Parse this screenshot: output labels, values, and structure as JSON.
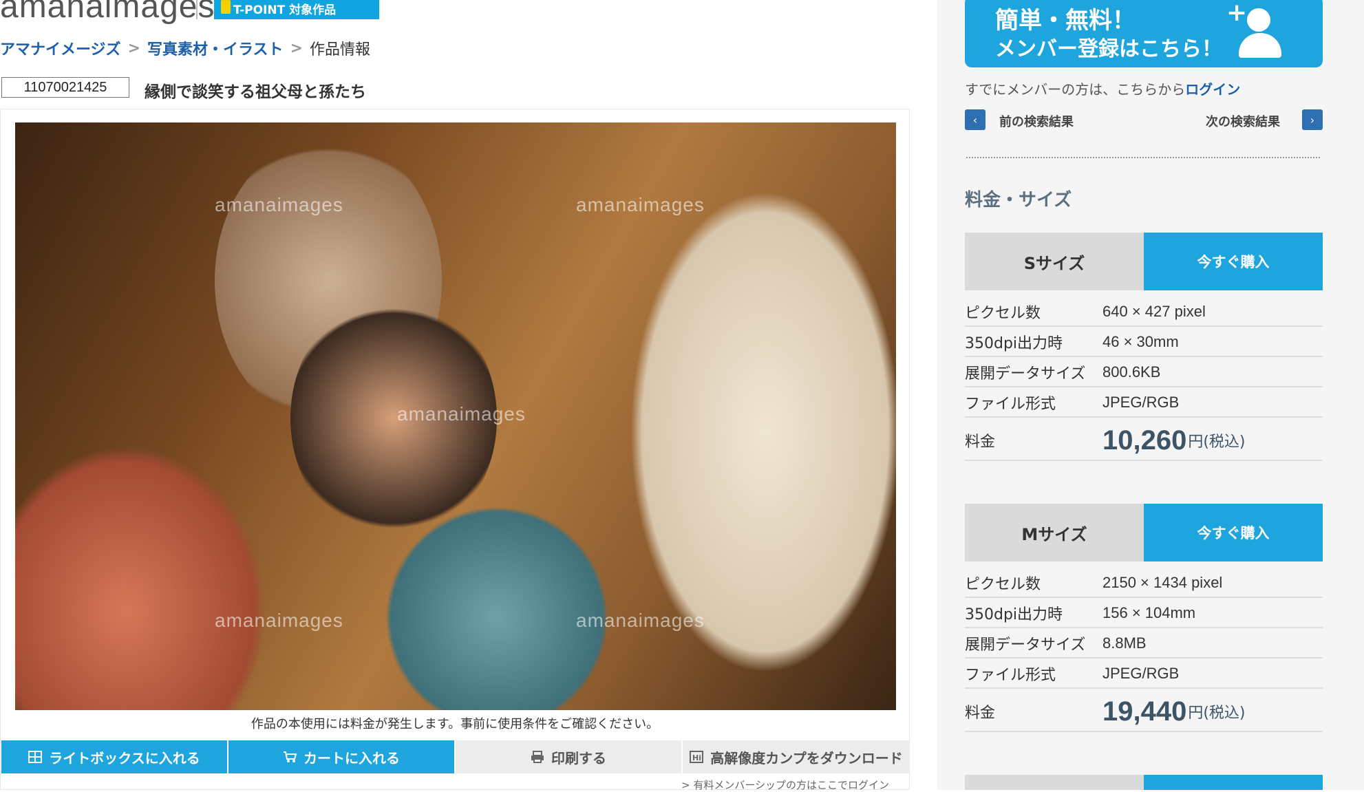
{
  "header": {
    "logo_text": "amanaimages",
    "tpoint_badge": "T-POINT 対象作品"
  },
  "breadcrumb": {
    "items": [
      "アマナイメージズ",
      "写真素材・イラスト"
    ],
    "separator": ">",
    "current": "作品情報"
  },
  "photo": {
    "id": "11070021425",
    "title": "縁側で談笑する祖父母と孫たち",
    "watermark": "amanaimages",
    "notice": "作品の本使用には料金が発生します。事前に使用条件をご確認ください。"
  },
  "actions": {
    "lightbox": "ライトボックスに入れる",
    "cart": "カートに入れる",
    "print": "印刷する",
    "download_comp": "高解像度カンプをダウンロード",
    "member_login": "> 有料メンバーシップの方はここでログイン"
  },
  "sidebar": {
    "banner_line1": "簡単・無料！",
    "banner_line2": "メンバー登録はこちら！",
    "banner_plus": "+",
    "login_prefix": "すでにメンバーの方は、こちらから",
    "login_link": "ログイン",
    "prev_label": "前の検索結果",
    "next_label": "次の検索結果",
    "prev_arrow": "‹",
    "next_arrow": "›",
    "section_title": "料金・サイズ"
  },
  "sizes": [
    {
      "name": "Sサイズ",
      "buy_label": "今すぐ購入",
      "specs": [
        {
          "label": "ピクセル数",
          "value": "640 × 427 pixel"
        },
        {
          "label": "350dpi出力時",
          "value": "46 × 30mm"
        },
        {
          "label": "展開データサイズ",
          "value": "800.6KB"
        },
        {
          "label": "ファイル形式",
          "value": "JPEG/RGB"
        }
      ],
      "price_label": "料金",
      "price": "10,260",
      "price_suffix": "円(税込)"
    },
    {
      "name": "Mサイズ",
      "buy_label": "今すぐ購入",
      "specs": [
        {
          "label": "ピクセル数",
          "value": "2150 × 1434 pixel"
        },
        {
          "label": "350dpi出力時",
          "value": "156 × 104mm"
        },
        {
          "label": "展開データサイズ",
          "value": "8.8MB"
        },
        {
          "label": "ファイル形式",
          "value": "JPEG/RGB"
        }
      ],
      "price_label": "料金",
      "price": "19,440",
      "price_suffix": "円(税込)"
    }
  ]
}
